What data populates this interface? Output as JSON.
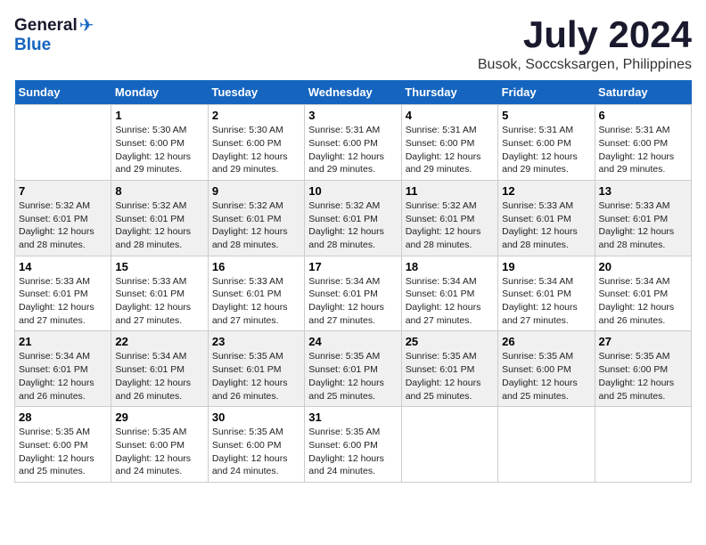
{
  "header": {
    "logo_general": "General",
    "logo_blue": "Blue",
    "month": "July 2024",
    "location": "Busok, Soccsksargen, Philippines"
  },
  "columns": [
    "Sunday",
    "Monday",
    "Tuesday",
    "Wednesday",
    "Thursday",
    "Friday",
    "Saturday"
  ],
  "weeks": [
    {
      "group": 1,
      "days": [
        {
          "num": "",
          "detail": ""
        },
        {
          "num": "1",
          "detail": "Sunrise: 5:30 AM\nSunset: 6:00 PM\nDaylight: 12 hours\nand 29 minutes."
        },
        {
          "num": "2",
          "detail": "Sunrise: 5:30 AM\nSunset: 6:00 PM\nDaylight: 12 hours\nand 29 minutes."
        },
        {
          "num": "3",
          "detail": "Sunrise: 5:31 AM\nSunset: 6:00 PM\nDaylight: 12 hours\nand 29 minutes."
        },
        {
          "num": "4",
          "detail": "Sunrise: 5:31 AM\nSunset: 6:00 PM\nDaylight: 12 hours\nand 29 minutes."
        },
        {
          "num": "5",
          "detail": "Sunrise: 5:31 AM\nSunset: 6:00 PM\nDaylight: 12 hours\nand 29 minutes."
        },
        {
          "num": "6",
          "detail": "Sunrise: 5:31 AM\nSunset: 6:00 PM\nDaylight: 12 hours\nand 29 minutes."
        }
      ]
    },
    {
      "group": 2,
      "days": [
        {
          "num": "7",
          "detail": "Sunrise: 5:32 AM\nSunset: 6:01 PM\nDaylight: 12 hours\nand 28 minutes."
        },
        {
          "num": "8",
          "detail": "Sunrise: 5:32 AM\nSunset: 6:01 PM\nDaylight: 12 hours\nand 28 minutes."
        },
        {
          "num": "9",
          "detail": "Sunrise: 5:32 AM\nSunset: 6:01 PM\nDaylight: 12 hours\nand 28 minutes."
        },
        {
          "num": "10",
          "detail": "Sunrise: 5:32 AM\nSunset: 6:01 PM\nDaylight: 12 hours\nand 28 minutes."
        },
        {
          "num": "11",
          "detail": "Sunrise: 5:32 AM\nSunset: 6:01 PM\nDaylight: 12 hours\nand 28 minutes."
        },
        {
          "num": "12",
          "detail": "Sunrise: 5:33 AM\nSunset: 6:01 PM\nDaylight: 12 hours\nand 28 minutes."
        },
        {
          "num": "13",
          "detail": "Sunrise: 5:33 AM\nSunset: 6:01 PM\nDaylight: 12 hours\nand 28 minutes."
        }
      ]
    },
    {
      "group": 3,
      "days": [
        {
          "num": "14",
          "detail": "Sunrise: 5:33 AM\nSunset: 6:01 PM\nDaylight: 12 hours\nand 27 minutes."
        },
        {
          "num": "15",
          "detail": "Sunrise: 5:33 AM\nSunset: 6:01 PM\nDaylight: 12 hours\nand 27 minutes."
        },
        {
          "num": "16",
          "detail": "Sunrise: 5:33 AM\nSunset: 6:01 PM\nDaylight: 12 hours\nand 27 minutes."
        },
        {
          "num": "17",
          "detail": "Sunrise: 5:34 AM\nSunset: 6:01 PM\nDaylight: 12 hours\nand 27 minutes."
        },
        {
          "num": "18",
          "detail": "Sunrise: 5:34 AM\nSunset: 6:01 PM\nDaylight: 12 hours\nand 27 minutes."
        },
        {
          "num": "19",
          "detail": "Sunrise: 5:34 AM\nSunset: 6:01 PM\nDaylight: 12 hours\nand 27 minutes."
        },
        {
          "num": "20",
          "detail": "Sunrise: 5:34 AM\nSunset: 6:01 PM\nDaylight: 12 hours\nand 26 minutes."
        }
      ]
    },
    {
      "group": 4,
      "days": [
        {
          "num": "21",
          "detail": "Sunrise: 5:34 AM\nSunset: 6:01 PM\nDaylight: 12 hours\nand 26 minutes."
        },
        {
          "num": "22",
          "detail": "Sunrise: 5:34 AM\nSunset: 6:01 PM\nDaylight: 12 hours\nand 26 minutes."
        },
        {
          "num": "23",
          "detail": "Sunrise: 5:35 AM\nSunset: 6:01 PM\nDaylight: 12 hours\nand 26 minutes."
        },
        {
          "num": "24",
          "detail": "Sunrise: 5:35 AM\nSunset: 6:01 PM\nDaylight: 12 hours\nand 25 minutes."
        },
        {
          "num": "25",
          "detail": "Sunrise: 5:35 AM\nSunset: 6:01 PM\nDaylight: 12 hours\nand 25 minutes."
        },
        {
          "num": "26",
          "detail": "Sunrise: 5:35 AM\nSunset: 6:00 PM\nDaylight: 12 hours\nand 25 minutes."
        },
        {
          "num": "27",
          "detail": "Sunrise: 5:35 AM\nSunset: 6:00 PM\nDaylight: 12 hours\nand 25 minutes."
        }
      ]
    },
    {
      "group": 5,
      "days": [
        {
          "num": "28",
          "detail": "Sunrise: 5:35 AM\nSunset: 6:00 PM\nDaylight: 12 hours\nand 25 minutes."
        },
        {
          "num": "29",
          "detail": "Sunrise: 5:35 AM\nSunset: 6:00 PM\nDaylight: 12 hours\nand 24 minutes."
        },
        {
          "num": "30",
          "detail": "Sunrise: 5:35 AM\nSunset: 6:00 PM\nDaylight: 12 hours\nand 24 minutes."
        },
        {
          "num": "31",
          "detail": "Sunrise: 5:35 AM\nSunset: 6:00 PM\nDaylight: 12 hours\nand 24 minutes."
        },
        {
          "num": "",
          "detail": ""
        },
        {
          "num": "",
          "detail": ""
        },
        {
          "num": "",
          "detail": ""
        }
      ]
    }
  ]
}
